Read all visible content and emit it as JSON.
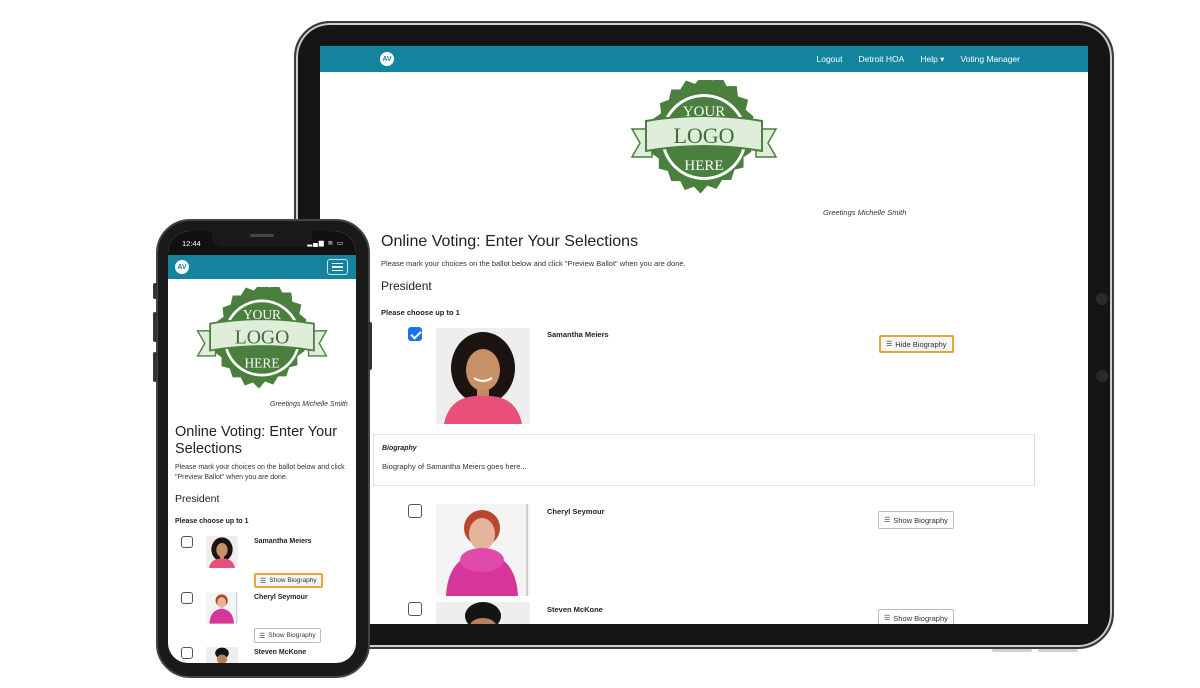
{
  "nav": {
    "logo_text": "AV",
    "links": [
      "Logout",
      "Detroit HOA",
      "Help ▾",
      "Voting Manager"
    ]
  },
  "logo": {
    "line1": "YOUR",
    "line2": "LOGO",
    "line3": "HERE"
  },
  "greeting": "Greetings Michelle Smith",
  "title": "Online Voting: Enter Your Selections",
  "intro": "Please mark your choices on the ballot below and click \"Preview Ballot\" when you are done.",
  "section": "President",
  "choose": "Please choose up to 1",
  "candidates": [
    {
      "name": "Samantha Meiers",
      "checked": true,
      "tablet_button": "Hide Biography",
      "phone_button": "Show Biography"
    },
    {
      "name": "Cheryl Seymour",
      "checked": false,
      "tablet_button": "Show Biography",
      "phone_button": "Show Biography"
    },
    {
      "name": "Steven McKone",
      "checked": false,
      "tablet_button": "Show Biography",
      "phone_button": "Show Biography"
    }
  ],
  "biography": {
    "heading": "Biography",
    "text": "Biography of Samantha Meiers goes here..."
  },
  "phone_status": {
    "time": "12:44",
    "icons": "▂▄▆ ≋ ▭"
  },
  "colors": {
    "nav": "#14849e",
    "logo_green": "#4a7f3e",
    "logo_light": "#dfeedb",
    "checkbox": "#1a73e8",
    "button_highlight": "#e8a43a"
  },
  "icons": {
    "bio_button": "list-icon",
    "menu": "hamburger-icon",
    "nav_brand": "brand-icon"
  }
}
